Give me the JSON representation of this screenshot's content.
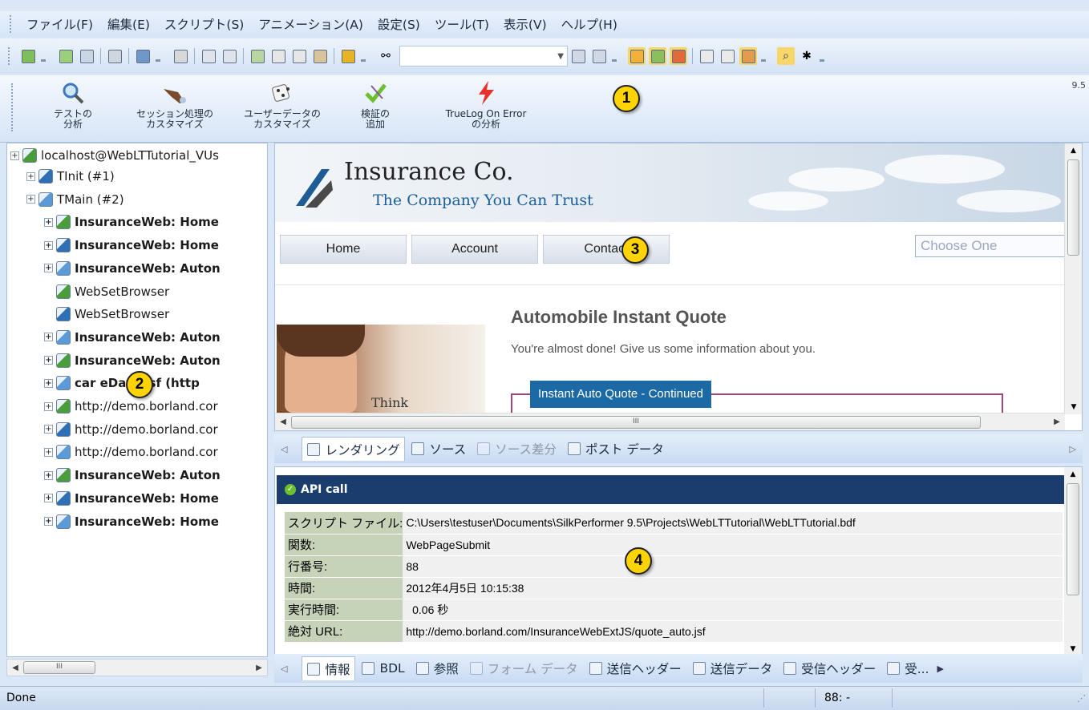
{
  "menu": [
    "ファイル(F)",
    "編集(E)",
    "スクリプト(S)",
    "アニメーション(A)",
    "設定(S)",
    "ツール(T)",
    "表示(V)",
    "ヘルプ(H)"
  ],
  "toolbar_big": {
    "version": "9.5",
    "buttons": [
      {
        "label": "テストの\n分析",
        "icon": "magnifier-icon"
      },
      {
        "label": "セッション処理の\nカスタマイズ",
        "icon": "hand-icon"
      },
      {
        "label": "ユーザーデータの\nカスタマイズ",
        "icon": "dice-icon"
      },
      {
        "label": "検証の\n追加",
        "icon": "checkmark-icon"
      },
      {
        "label": "TrueLog On Error\nの分析",
        "icon": "lightning-icon"
      }
    ]
  },
  "callouts": [
    "1",
    "2",
    "3",
    "4"
  ],
  "tree": {
    "root": "localhost@WebLTTutorial_VUs",
    "nodes": [
      {
        "text": "TInit (#1)",
        "bold": false,
        "level": 1
      },
      {
        "text": "TMain (#2)",
        "bold": false,
        "level": 1
      },
      {
        "text": "InsuranceWeb: Home",
        "bold": true,
        "level": 2
      },
      {
        "text": "InsuranceWeb: Home",
        "bold": true,
        "level": 2
      },
      {
        "text": "InsuranceWeb: Auton",
        "bold": true,
        "level": 2
      },
      {
        "text": "WebSetBrowser",
        "bold": false,
        "level": 2
      },
      {
        "text": "WebSetBrowser",
        "bold": false,
        "level": 2
      },
      {
        "text": "InsuranceWeb: Auton",
        "bold": true,
        "level": 2
      },
      {
        "text": "InsuranceWeb: Auton",
        "bold": true,
        "level": 2
      },
      {
        "text": "car  eData.jsf (http",
        "bold": true,
        "level": 2
      },
      {
        "text": "http://demo.borland.cor",
        "bold": false,
        "level": 2
      },
      {
        "text": "http://demo.borland.cor",
        "bold": false,
        "level": 2
      },
      {
        "text": "http://demo.borland.cor",
        "bold": false,
        "level": 2
      },
      {
        "text": "InsuranceWeb: Auton",
        "bold": true,
        "level": 2
      },
      {
        "text": "InsuranceWeb: Home",
        "bold": true,
        "level": 2
      },
      {
        "text": "InsuranceWeb: Home",
        "bold": true,
        "level": 2
      }
    ]
  },
  "site": {
    "company": "Insurance Co.",
    "tagline": "The Company You Can Trust",
    "nav": [
      "Home",
      "Account",
      "Contact"
    ],
    "choose": "Choose One",
    "quote_title": "Automobile Instant Quote",
    "quote_text": "You're almost done! Give us some information about you.",
    "form_legend": "Instant Auto Quote - Continued",
    "photo_caption": "Think"
  },
  "view_tabs": [
    {
      "label": "レンダリング",
      "active": true,
      "disabled": false
    },
    {
      "label": "ソース",
      "active": false,
      "disabled": false
    },
    {
      "label": "ソース差分",
      "active": false,
      "disabled": true
    },
    {
      "label": "ポスト データ",
      "active": false,
      "disabled": false
    }
  ],
  "info": {
    "header": "API call",
    "rows": [
      {
        "key": "スクリプト ファイル:",
        "value": "C:\\Users\\testuser\\Documents\\SilkPerformer 9.5\\Projects\\WebLTTutorial\\WebLTTutorial.bdf"
      },
      {
        "key": "関数:",
        "value": "WebPageSubmit"
      },
      {
        "key": "行番号:",
        "value": "88"
      },
      {
        "key": "時間:",
        "value": "2012年4月5日 10:15:38"
      },
      {
        "key": "実行時間:",
        "value": "  0.06 秒"
      },
      {
        "key": "絶対 URL:",
        "value": "http://demo.borland.com/InsuranceWebExtJS/quote_auto.jsf"
      }
    ]
  },
  "info_tabs": [
    {
      "label": "情報",
      "active": true,
      "disabled": false
    },
    {
      "label": "BDL",
      "active": false,
      "disabled": false
    },
    {
      "label": "参照",
      "active": false,
      "disabled": false
    },
    {
      "label": "フォーム データ",
      "active": false,
      "disabled": true
    },
    {
      "label": "送信ヘッダー",
      "active": false,
      "disabled": false
    },
    {
      "label": "送信データ",
      "active": false,
      "disabled": false
    },
    {
      "label": "受信ヘッダー",
      "active": false,
      "disabled": false
    },
    {
      "label": "受...",
      "active": false,
      "disabled": false
    }
  ],
  "status": {
    "left": "Done",
    "position": "88: -"
  },
  "scroll_thumb": "III"
}
